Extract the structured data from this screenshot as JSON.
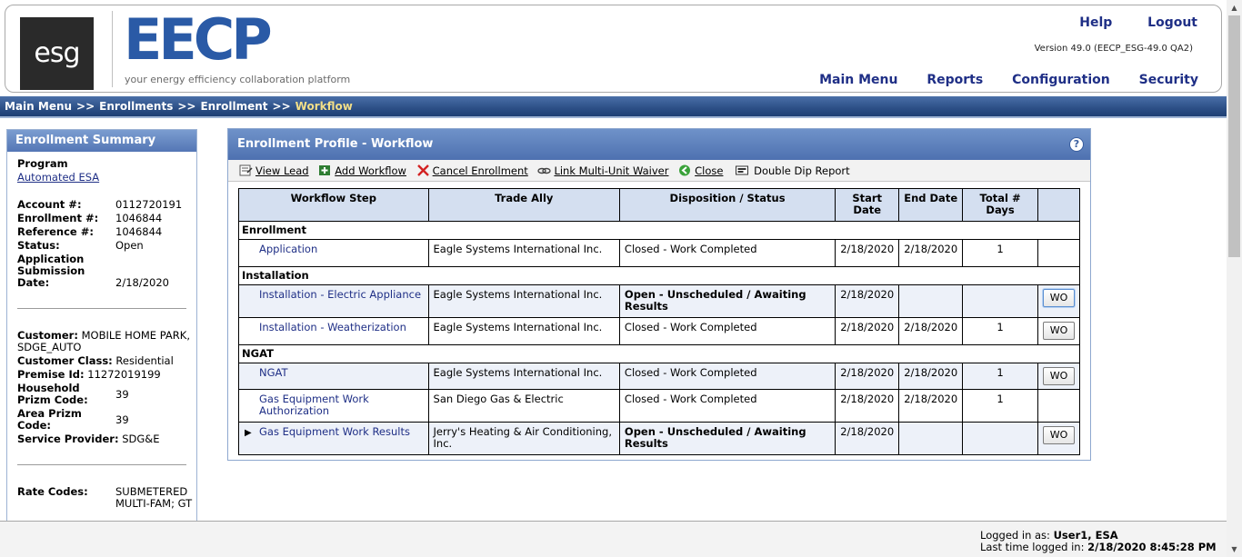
{
  "header": {
    "logo_text": "esg",
    "brand": "EECP",
    "tagline": "your energy efficiency collaboration platform",
    "help_label": "Help",
    "logout_label": "Logout",
    "version": "Version 49.0 (EECP_ESG-49.0 QA2)",
    "nav": [
      "Main Menu",
      "Reports",
      "Configuration",
      "Security"
    ]
  },
  "breadcrumb": [
    "Main Menu",
    "Enrollments",
    "Enrollment",
    "Workflow"
  ],
  "breadcrumb_separator": ">>",
  "summary": {
    "title": "Enrollment Summary",
    "program_label": "Program",
    "program_value": "Automated ESA",
    "account_label": "Account #:",
    "account_value": "0112720191",
    "enrollment_label": "Enrollment #:",
    "enrollment_value": "1046844",
    "reference_label": "Reference #:",
    "reference_value": "1046844",
    "status_label": "Status:",
    "status_value": "Open",
    "submission_label_1": "Application",
    "submission_label_2": "Submission",
    "submission_label_3": "Date:",
    "submission_value": "2/18/2020",
    "customer_label": "Customer:",
    "customer_value_1": "MOBILE HOME PARK,",
    "customer_value_2": "SDGE_AUTO",
    "customer_class_label": "Customer Class:",
    "customer_class_value": "Residential",
    "premise_label": "Premise Id:",
    "premise_value": "11272019199",
    "household_label_1": "Household",
    "household_label_2": "Prizm Code:",
    "household_value": "39",
    "area_label_1": "Area Prizm",
    "area_label_2": "Code:",
    "area_value": "39",
    "provider_label": "Service Provider:",
    "provider_value": "SDG&E",
    "rate_label": "Rate Codes:",
    "rate_value_1": "SUBMETERED",
    "rate_value_2": "MULTI-FAM; GT"
  },
  "panel": {
    "title": "Enrollment Profile - Workflow",
    "help": "?",
    "toolbar": [
      "View Lead",
      "Add Workflow",
      "Cancel Enrollment",
      "Link Multi-Unit Waiver",
      "Close",
      "Double Dip Report"
    ]
  },
  "table": {
    "columns": [
      "Workflow Step",
      "Trade Ally",
      "Disposition / Status",
      "Start Date",
      "End Date",
      "Total # Days",
      ""
    ],
    "groups": [
      {
        "name": "Enrollment",
        "rows": [
          {
            "step": "Application",
            "ally": "Eagle Systems International Inc.",
            "status": "Closed - Work Completed",
            "start": "2/18/2020",
            "end": "2/18/2020",
            "days": "1",
            "wo": ""
          }
        ]
      },
      {
        "name": "Installation",
        "rows": [
          {
            "step": "Installation - Electric Appliance",
            "ally": "Eagle Systems International Inc.",
            "status": "Open - Unscheduled / Awaiting Results",
            "start": "2/18/2020",
            "end": "",
            "days": "",
            "wo": "WO"
          },
          {
            "step": "Installation - Weatherization",
            "ally": "Eagle Systems International Inc.",
            "status": "Closed - Work Completed",
            "start": "2/18/2020",
            "end": "2/18/2020",
            "days": "1",
            "wo": "WO"
          }
        ]
      },
      {
        "name": "NGAT",
        "rows": [
          {
            "step": "NGAT",
            "ally": "Eagle Systems International Inc.",
            "status": "Closed - Work Completed",
            "start": "2/18/2020",
            "end": "2/18/2020",
            "days": "1",
            "wo": "WO"
          },
          {
            "step": "Gas Equipment Work Authorization",
            "ally": "San Diego Gas & Electric",
            "status": "Closed - Work Completed",
            "start": "2/18/2020",
            "end": "2/18/2020",
            "days": "1",
            "wo": ""
          },
          {
            "step": "Gas Equipment Work Results",
            "ally": "Jerry's Heating & Air Conditioning, Inc.",
            "status": "Open - Unscheduled / Awaiting Results",
            "start": "2/18/2020",
            "end": "",
            "days": "",
            "wo": "WO"
          }
        ]
      }
    ]
  },
  "footer": {
    "logged_in_label": "Logged in as:",
    "logged_in_value": "User1, ESA",
    "last_login_label": "Last time logged in:",
    "last_login_value": "2/18/2020 8:45:28 PM"
  }
}
